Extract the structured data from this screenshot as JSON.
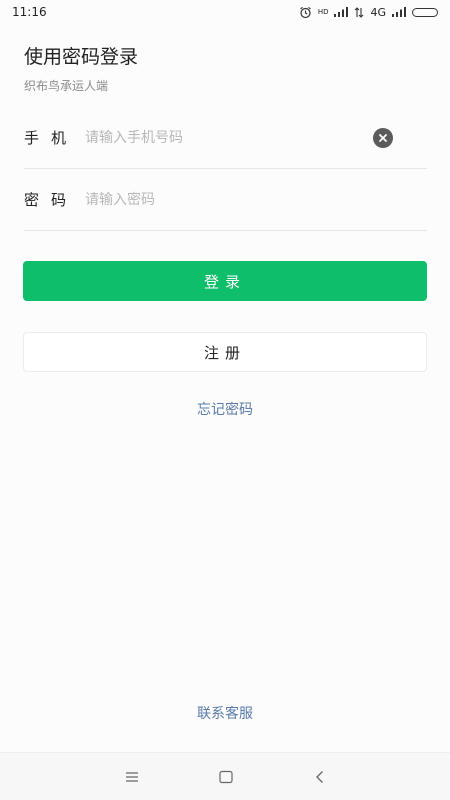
{
  "status_bar": {
    "time": "11:16",
    "hd_label": "HD",
    "network": "4G"
  },
  "header": {
    "title": "使用密码登录",
    "subtitle": "织布鸟承运人端"
  },
  "form": {
    "phone": {
      "label": "手机",
      "placeholder": "请输入手机号码",
      "value": ""
    },
    "password": {
      "label": "密码",
      "placeholder": "请输入密码",
      "value": ""
    }
  },
  "buttons": {
    "login": "登录",
    "register": "注册",
    "forgot_password": "忘记密码"
  },
  "footer": {
    "contact": "联系客服"
  },
  "colors": {
    "primary": "#0ebe6a",
    "link": "#5a7ba8"
  },
  "icons": {
    "clear": "clear-icon",
    "alarm": "alarm-icon",
    "signal": "signal-icon",
    "battery": "battery-icon",
    "menu": "menu-icon",
    "home": "home-icon",
    "back": "back-icon"
  }
}
